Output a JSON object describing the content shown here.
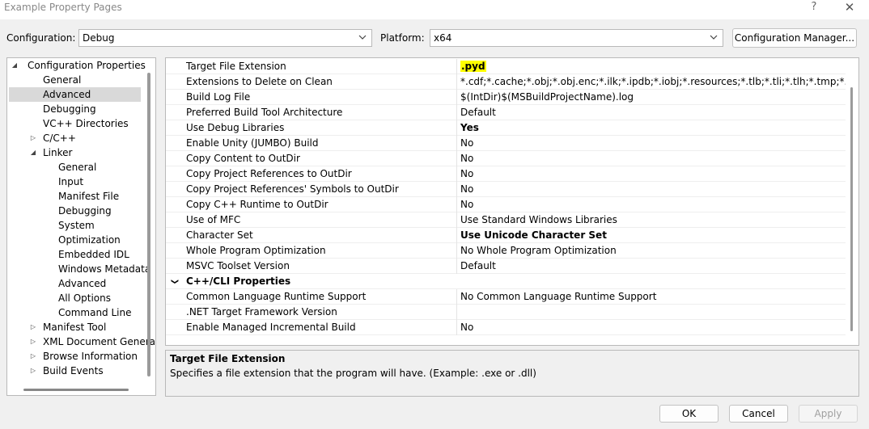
{
  "window": {
    "title": "Example Property Pages",
    "help": "?",
    "close": "✕"
  },
  "config_bar": {
    "configuration_label": "Configuration:",
    "configuration_value": "Debug",
    "platform_label": "Platform:",
    "platform_value": "x64",
    "manager_button": "Configuration Manager..."
  },
  "tree": {
    "items": [
      {
        "label": "Configuration Properties",
        "expander": "◢"
      },
      {
        "label": "General"
      },
      {
        "label": "Advanced",
        "selected": true
      },
      {
        "label": "Debugging"
      },
      {
        "label": "VC++ Directories"
      },
      {
        "label": "C/C++",
        "expander": "▷"
      },
      {
        "label": "Linker",
        "expander": "◢"
      },
      {
        "label": "General"
      },
      {
        "label": "Input"
      },
      {
        "label": "Manifest File"
      },
      {
        "label": "Debugging"
      },
      {
        "label": "System"
      },
      {
        "label": "Optimization"
      },
      {
        "label": "Embedded IDL"
      },
      {
        "label": "Windows Metadata"
      },
      {
        "label": "Advanced"
      },
      {
        "label": "All Options"
      },
      {
        "label": "Command Line"
      },
      {
        "label": "Manifest Tool",
        "expander": "▷"
      },
      {
        "label": "XML Document Generator",
        "expander": "▷"
      },
      {
        "label": "Browse Information",
        "expander": "▷"
      },
      {
        "label": "Build Events",
        "expander": "▷"
      }
    ]
  },
  "grid": {
    "rows": [
      {
        "name": "Target File Extension",
        "value": ".pyd"
      },
      {
        "name": "Extensions to Delete on Clean",
        "value": "*.cdf;*.cache;*.obj;*.obj.enc;*.ilk;*.ipdb;*.iobj;*.resources;*.tlb;*.tli;*.tlh;*.tmp;*.rsp;*.pgc;*.p"
      },
      {
        "name": "Build Log File",
        "value": "$(IntDir)$(MSBuildProjectName).log"
      },
      {
        "name": "Preferred Build Tool Architecture",
        "value": "Default"
      },
      {
        "name": "Use Debug Libraries",
        "value": "Yes"
      },
      {
        "name": "Enable Unity (JUMBO) Build",
        "value": "No"
      },
      {
        "name": "Copy Content to OutDir",
        "value": "No"
      },
      {
        "name": "Copy Project References to OutDir",
        "value": "No"
      },
      {
        "name": "Copy Project References' Symbols to OutDir",
        "value": "No"
      },
      {
        "name": "Copy C++ Runtime to OutDir",
        "value": "No"
      },
      {
        "name": "Use of MFC",
        "value": "Use Standard Windows Libraries"
      },
      {
        "name": "Character Set",
        "value": "Use Unicode Character Set"
      },
      {
        "name": "Whole Program Optimization",
        "value": "No Whole Program Optimization"
      },
      {
        "name": "MSVC Toolset Version",
        "value": "Default"
      },
      {
        "name": "C++/CLI Properties",
        "value": "",
        "chevron": "❯"
      },
      {
        "name": "Common Language Runtime Support",
        "value": "No Common Language Runtime Support"
      },
      {
        "name": ".NET Target Framework Version",
        "value": ""
      },
      {
        "name": "Enable Managed Incremental Build",
        "value": "No"
      }
    ]
  },
  "description": {
    "title": "Target File Extension",
    "text": "Specifies a file extension that the program will have. (Example: .exe or .dll)"
  },
  "buttons": {
    "ok": "OK",
    "cancel": "Cancel",
    "apply": "Apply"
  }
}
